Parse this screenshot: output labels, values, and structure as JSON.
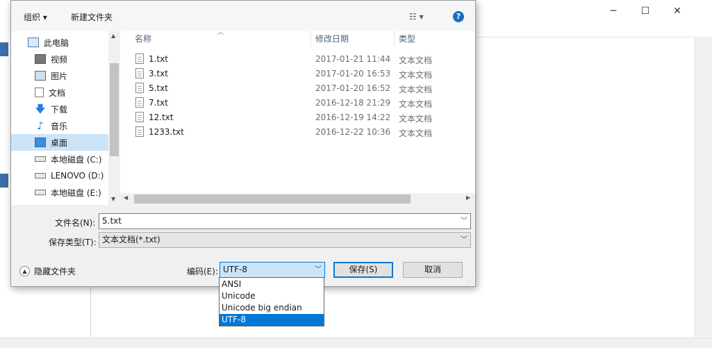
{
  "background_window": {
    "controls": {
      "minimize": "─",
      "maximize": "☐",
      "close": "✕"
    }
  },
  "toolbar": {
    "organize_label": "组织 ▾",
    "new_folder_label": "新建文件夹",
    "view_label": "☷ ▾",
    "help_label": "?"
  },
  "nav": {
    "items": [
      {
        "label": "此电脑",
        "icon": "computer-icon"
      },
      {
        "label": "视频",
        "icon": "video-icon"
      },
      {
        "label": "图片",
        "icon": "picture-icon"
      },
      {
        "label": "文档",
        "icon": "document-icon"
      },
      {
        "label": "下载",
        "icon": "download-icon"
      },
      {
        "label": "音乐",
        "icon": "music-icon"
      },
      {
        "label": "桌面",
        "icon": "desktop-icon"
      },
      {
        "label": "本地磁盘 (C:)",
        "icon": "drive-icon"
      },
      {
        "label": "LENOVO (D:)",
        "icon": "drive-icon"
      },
      {
        "label": "本地磁盘 (E:)",
        "icon": "drive-icon"
      }
    ],
    "selected_index": 6
  },
  "file_list": {
    "columns": {
      "name": "名称",
      "modified": "修改日期",
      "type": "类型"
    },
    "rows": [
      {
        "name": "1.txt",
        "modified": "2017-01-21 11:44",
        "type": "文本文档"
      },
      {
        "name": "3.txt",
        "modified": "2017-01-20 16:53",
        "type": "文本文档"
      },
      {
        "name": "5.txt",
        "modified": "2017-01-20 16:52",
        "type": "文本文档"
      },
      {
        "name": "7.txt",
        "modified": "2016-12-18 21:29",
        "type": "文本文档"
      },
      {
        "name": "12.txt",
        "modified": "2016-12-19 14:22",
        "type": "文本文档"
      },
      {
        "name": "1233.txt",
        "modified": "2016-12-22 10:36",
        "type": "文本文档"
      }
    ]
  },
  "form": {
    "filename_label": "文件名(N):",
    "filename_value": "5.txt",
    "filetype_label": "保存类型(T):",
    "filetype_value": "文本文档(*.txt)",
    "encoding_label": "编码(E):",
    "encoding_value": "UTF-8",
    "save_label": "保存(S)",
    "cancel_label": "取消",
    "hide_folders_label": "隐藏文件夹"
  },
  "encoding_options": [
    "ANSI",
    "Unicode",
    "Unicode big endian",
    "UTF-8"
  ],
  "encoding_selected_index": 3,
  "colors": {
    "accent": "#0078d7",
    "nav_selected": "#cce4f7",
    "help": "#1b6ec2"
  }
}
